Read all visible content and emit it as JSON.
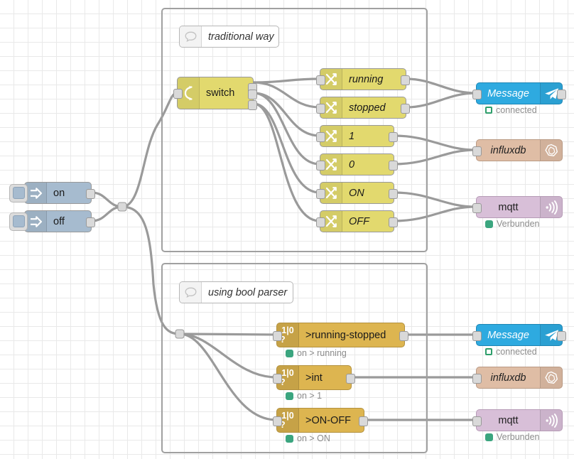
{
  "editor": {
    "title": "Node-RED flow editor canvas",
    "grid_size": 20,
    "colors": {
      "inject": "#a6bbcf",
      "switch": "#e2d96e",
      "change": "#e2d96e",
      "telegram": "#2eaae0",
      "influxdb": "#dfbda5",
      "mqtt": "#d8bfd8",
      "bool_parser": "#ddb550",
      "wire": "#9a9a9a",
      "group_border": "#a0a0a0",
      "status_ok": "#3ba57f"
    }
  },
  "groups": [
    {
      "name": "traditional-way",
      "comment_label": "traditional way"
    },
    {
      "name": "using-bool-parser",
      "comment_label": "using bool parser"
    }
  ],
  "inject_nodes": [
    {
      "label": "on",
      "icon": "inject-arrow-icon",
      "button": "inject-button"
    },
    {
      "label": "off",
      "icon": "inject-arrow-icon",
      "button": "inject-button"
    }
  ],
  "switch_node": {
    "label": "switch",
    "icon": "switch-branch-icon",
    "outputs": 3,
    "inputs": 1
  },
  "change_nodes": [
    {
      "label": "running",
      "icon": "change-swap-icon"
    },
    {
      "label": "stopped",
      "icon": "change-swap-icon"
    },
    {
      "label": "1",
      "icon": "change-swap-icon"
    },
    {
      "label": "0",
      "icon": "change-swap-icon"
    },
    {
      "label": "ON",
      "icon": "change-swap-icon"
    },
    {
      "label": "OFF",
      "icon": "change-swap-icon"
    }
  ],
  "bool_parser_nodes": [
    {
      "label": ">running-stopped",
      "icon": "bool-parser-icon",
      "icon_text_top": "1|0",
      "icon_text_bottom": "?",
      "status": "on > running"
    },
    {
      "label": ">int",
      "icon": "bool-parser-icon",
      "icon_text_top": "1|0",
      "icon_text_bottom": "?",
      "status": "on > 1"
    },
    {
      "label": ">ON-OFF",
      "icon": "bool-parser-icon",
      "icon_text_top": "1|0",
      "icon_text_bottom": "?",
      "status": "on > ON"
    }
  ],
  "output_nodes_top": [
    {
      "label": "Message",
      "icon": "telegram-send-icon",
      "status": "connected",
      "status_style": "ring"
    },
    {
      "label": "influxdb",
      "icon": "influxdb-icon",
      "status": "",
      "status_style": "none"
    },
    {
      "label": "mqtt",
      "icon": "mqtt-broadcast-icon",
      "status": "Verbunden",
      "status_style": "fill"
    }
  ],
  "output_nodes_bottom": [
    {
      "label": "Message",
      "icon": "telegram-send-icon",
      "status": "connected",
      "status_style": "ring"
    },
    {
      "label": "influxdb",
      "icon": "influxdb-icon",
      "status": "",
      "status_style": "none"
    },
    {
      "label": "mqtt",
      "icon": "mqtt-broadcast-icon",
      "status": "Verbunden",
      "status_style": "fill"
    }
  ]
}
